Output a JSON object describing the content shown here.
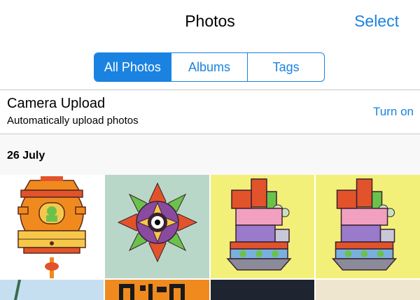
{
  "nav": {
    "title": "Photos",
    "select_label": "Select"
  },
  "tabs": [
    {
      "label": "All Photos",
      "active": true
    },
    {
      "label": "Albums",
      "active": false
    },
    {
      "label": "Tags",
      "active": false
    }
  ],
  "camera_upload": {
    "title": "Camera Upload",
    "subtitle": "Automatically upload photos",
    "action_label": "Turn on"
  },
  "section": {
    "date_label": "26 July"
  },
  "colors": {
    "accent": "#1a82e0",
    "tile_mandala_bg": "#b9d7c9",
    "tile_castle_bg": "#f3f07a",
    "tile_sky_bg": "#c6dff0",
    "tile_orange_bg": "#f08a1f",
    "tile_dark_bg": "#1f2530",
    "tile_beige_bg": "#efe6cf"
  },
  "photos": [
    {
      "name": "birdhouse-illustration"
    },
    {
      "name": "mandala-illustration"
    },
    {
      "name": "castle-illustration"
    },
    {
      "name": "castle-illustration-copy"
    },
    {
      "name": "sky-photo"
    },
    {
      "name": "qr-code-photo"
    },
    {
      "name": "dark-photo"
    },
    {
      "name": "beige-photo"
    }
  ]
}
